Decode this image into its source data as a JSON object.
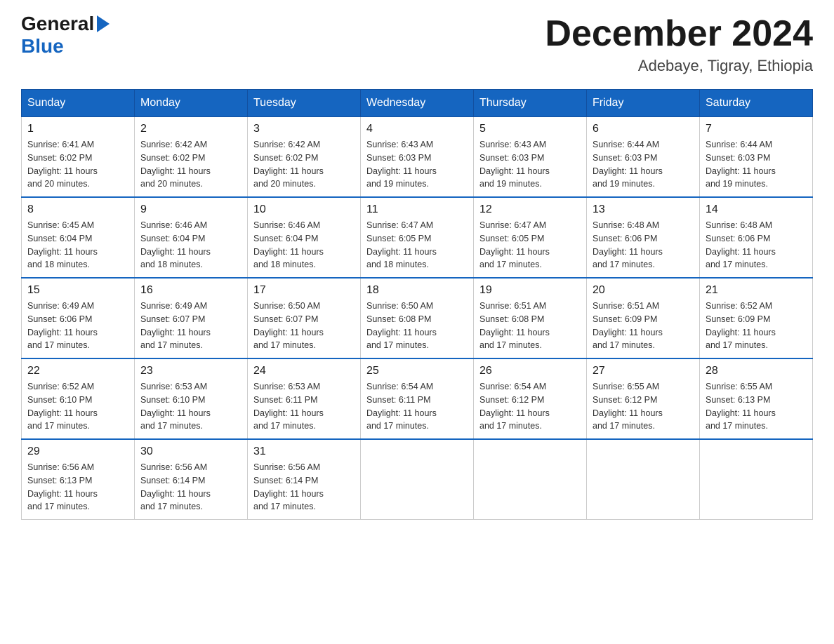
{
  "logo": {
    "general": "General",
    "blue": "Blue"
  },
  "title": {
    "month": "December 2024",
    "location": "Adebaye, Tigray, Ethiopia"
  },
  "days_header": [
    "Sunday",
    "Monday",
    "Tuesday",
    "Wednesday",
    "Thursday",
    "Friday",
    "Saturday"
  ],
  "weeks": [
    [
      {
        "day": "1",
        "sunrise": "6:41 AM",
        "sunset": "6:02 PM",
        "daylight": "11 hours and 20 minutes."
      },
      {
        "day": "2",
        "sunrise": "6:42 AM",
        "sunset": "6:02 PM",
        "daylight": "11 hours and 20 minutes."
      },
      {
        "day": "3",
        "sunrise": "6:42 AM",
        "sunset": "6:02 PM",
        "daylight": "11 hours and 20 minutes."
      },
      {
        "day": "4",
        "sunrise": "6:43 AM",
        "sunset": "6:03 PM",
        "daylight": "11 hours and 19 minutes."
      },
      {
        "day": "5",
        "sunrise": "6:43 AM",
        "sunset": "6:03 PM",
        "daylight": "11 hours and 19 minutes."
      },
      {
        "day": "6",
        "sunrise": "6:44 AM",
        "sunset": "6:03 PM",
        "daylight": "11 hours and 19 minutes."
      },
      {
        "day": "7",
        "sunrise": "6:44 AM",
        "sunset": "6:03 PM",
        "daylight": "11 hours and 19 minutes."
      }
    ],
    [
      {
        "day": "8",
        "sunrise": "6:45 AM",
        "sunset": "6:04 PM",
        "daylight": "11 hours and 18 minutes."
      },
      {
        "day": "9",
        "sunrise": "6:46 AM",
        "sunset": "6:04 PM",
        "daylight": "11 hours and 18 minutes."
      },
      {
        "day": "10",
        "sunrise": "6:46 AM",
        "sunset": "6:04 PM",
        "daylight": "11 hours and 18 minutes."
      },
      {
        "day": "11",
        "sunrise": "6:47 AM",
        "sunset": "6:05 PM",
        "daylight": "11 hours and 18 minutes."
      },
      {
        "day": "12",
        "sunrise": "6:47 AM",
        "sunset": "6:05 PM",
        "daylight": "11 hours and 17 minutes."
      },
      {
        "day": "13",
        "sunrise": "6:48 AM",
        "sunset": "6:06 PM",
        "daylight": "11 hours and 17 minutes."
      },
      {
        "day": "14",
        "sunrise": "6:48 AM",
        "sunset": "6:06 PM",
        "daylight": "11 hours and 17 minutes."
      }
    ],
    [
      {
        "day": "15",
        "sunrise": "6:49 AM",
        "sunset": "6:06 PM",
        "daylight": "11 hours and 17 minutes."
      },
      {
        "day": "16",
        "sunrise": "6:49 AM",
        "sunset": "6:07 PM",
        "daylight": "11 hours and 17 minutes."
      },
      {
        "day": "17",
        "sunrise": "6:50 AM",
        "sunset": "6:07 PM",
        "daylight": "11 hours and 17 minutes."
      },
      {
        "day": "18",
        "sunrise": "6:50 AM",
        "sunset": "6:08 PM",
        "daylight": "11 hours and 17 minutes."
      },
      {
        "day": "19",
        "sunrise": "6:51 AM",
        "sunset": "6:08 PM",
        "daylight": "11 hours and 17 minutes."
      },
      {
        "day": "20",
        "sunrise": "6:51 AM",
        "sunset": "6:09 PM",
        "daylight": "11 hours and 17 minutes."
      },
      {
        "day": "21",
        "sunrise": "6:52 AM",
        "sunset": "6:09 PM",
        "daylight": "11 hours and 17 minutes."
      }
    ],
    [
      {
        "day": "22",
        "sunrise": "6:52 AM",
        "sunset": "6:10 PM",
        "daylight": "11 hours and 17 minutes."
      },
      {
        "day": "23",
        "sunrise": "6:53 AM",
        "sunset": "6:10 PM",
        "daylight": "11 hours and 17 minutes."
      },
      {
        "day": "24",
        "sunrise": "6:53 AM",
        "sunset": "6:11 PM",
        "daylight": "11 hours and 17 minutes."
      },
      {
        "day": "25",
        "sunrise": "6:54 AM",
        "sunset": "6:11 PM",
        "daylight": "11 hours and 17 minutes."
      },
      {
        "day": "26",
        "sunrise": "6:54 AM",
        "sunset": "6:12 PM",
        "daylight": "11 hours and 17 minutes."
      },
      {
        "day": "27",
        "sunrise": "6:55 AM",
        "sunset": "6:12 PM",
        "daylight": "11 hours and 17 minutes."
      },
      {
        "day": "28",
        "sunrise": "6:55 AM",
        "sunset": "6:13 PM",
        "daylight": "11 hours and 17 minutes."
      }
    ],
    [
      {
        "day": "29",
        "sunrise": "6:56 AM",
        "sunset": "6:13 PM",
        "daylight": "11 hours and 17 minutes."
      },
      {
        "day": "30",
        "sunrise": "6:56 AM",
        "sunset": "6:14 PM",
        "daylight": "11 hours and 17 minutes."
      },
      {
        "day": "31",
        "sunrise": "6:56 AM",
        "sunset": "6:14 PM",
        "daylight": "11 hours and 17 minutes."
      },
      null,
      null,
      null,
      null
    ]
  ],
  "labels": {
    "sunrise": "Sunrise:",
    "sunset": "Sunset:",
    "daylight": "Daylight:"
  }
}
